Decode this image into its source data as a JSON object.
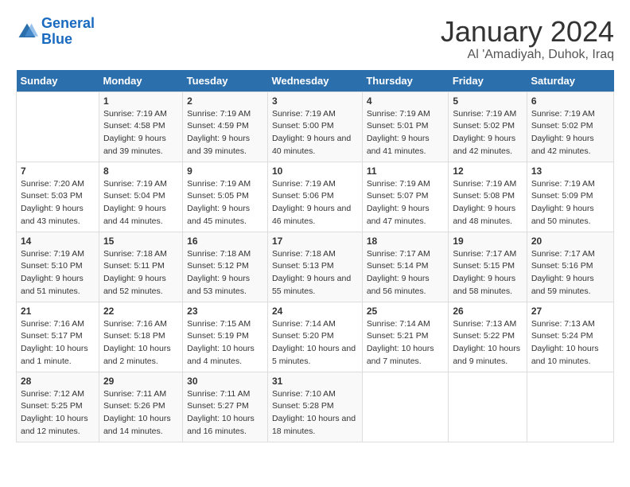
{
  "header": {
    "logo_line1": "General",
    "logo_line2": "Blue",
    "title": "January 2024",
    "subtitle": "Al 'Amadiyah, Duhok, Iraq"
  },
  "days_of_week": [
    "Sunday",
    "Monday",
    "Tuesday",
    "Wednesday",
    "Thursday",
    "Friday",
    "Saturday"
  ],
  "weeks": [
    [
      {
        "num": "",
        "sunrise": "",
        "sunset": "",
        "daylight": ""
      },
      {
        "num": "1",
        "sunrise": "Sunrise: 7:19 AM",
        "sunset": "Sunset: 4:58 PM",
        "daylight": "Daylight: 9 hours and 39 minutes."
      },
      {
        "num": "2",
        "sunrise": "Sunrise: 7:19 AM",
        "sunset": "Sunset: 4:59 PM",
        "daylight": "Daylight: 9 hours and 39 minutes."
      },
      {
        "num": "3",
        "sunrise": "Sunrise: 7:19 AM",
        "sunset": "Sunset: 5:00 PM",
        "daylight": "Daylight: 9 hours and 40 minutes."
      },
      {
        "num": "4",
        "sunrise": "Sunrise: 7:19 AM",
        "sunset": "Sunset: 5:01 PM",
        "daylight": "Daylight: 9 hours and 41 minutes."
      },
      {
        "num": "5",
        "sunrise": "Sunrise: 7:19 AM",
        "sunset": "Sunset: 5:02 PM",
        "daylight": "Daylight: 9 hours and 42 minutes."
      },
      {
        "num": "6",
        "sunrise": "Sunrise: 7:19 AM",
        "sunset": "Sunset: 5:02 PM",
        "daylight": "Daylight: 9 hours and 42 minutes."
      }
    ],
    [
      {
        "num": "7",
        "sunrise": "Sunrise: 7:20 AM",
        "sunset": "Sunset: 5:03 PM",
        "daylight": "Daylight: 9 hours and 43 minutes."
      },
      {
        "num": "8",
        "sunrise": "Sunrise: 7:19 AM",
        "sunset": "Sunset: 5:04 PM",
        "daylight": "Daylight: 9 hours and 44 minutes."
      },
      {
        "num": "9",
        "sunrise": "Sunrise: 7:19 AM",
        "sunset": "Sunset: 5:05 PM",
        "daylight": "Daylight: 9 hours and 45 minutes."
      },
      {
        "num": "10",
        "sunrise": "Sunrise: 7:19 AM",
        "sunset": "Sunset: 5:06 PM",
        "daylight": "Daylight: 9 hours and 46 minutes."
      },
      {
        "num": "11",
        "sunrise": "Sunrise: 7:19 AM",
        "sunset": "Sunset: 5:07 PM",
        "daylight": "Daylight: 9 hours and 47 minutes."
      },
      {
        "num": "12",
        "sunrise": "Sunrise: 7:19 AM",
        "sunset": "Sunset: 5:08 PM",
        "daylight": "Daylight: 9 hours and 48 minutes."
      },
      {
        "num": "13",
        "sunrise": "Sunrise: 7:19 AM",
        "sunset": "Sunset: 5:09 PM",
        "daylight": "Daylight: 9 hours and 50 minutes."
      }
    ],
    [
      {
        "num": "14",
        "sunrise": "Sunrise: 7:19 AM",
        "sunset": "Sunset: 5:10 PM",
        "daylight": "Daylight: 9 hours and 51 minutes."
      },
      {
        "num": "15",
        "sunrise": "Sunrise: 7:18 AM",
        "sunset": "Sunset: 5:11 PM",
        "daylight": "Daylight: 9 hours and 52 minutes."
      },
      {
        "num": "16",
        "sunrise": "Sunrise: 7:18 AM",
        "sunset": "Sunset: 5:12 PM",
        "daylight": "Daylight: 9 hours and 53 minutes."
      },
      {
        "num": "17",
        "sunrise": "Sunrise: 7:18 AM",
        "sunset": "Sunset: 5:13 PM",
        "daylight": "Daylight: 9 hours and 55 minutes."
      },
      {
        "num": "18",
        "sunrise": "Sunrise: 7:17 AM",
        "sunset": "Sunset: 5:14 PM",
        "daylight": "Daylight: 9 hours and 56 minutes."
      },
      {
        "num": "19",
        "sunrise": "Sunrise: 7:17 AM",
        "sunset": "Sunset: 5:15 PM",
        "daylight": "Daylight: 9 hours and 58 minutes."
      },
      {
        "num": "20",
        "sunrise": "Sunrise: 7:17 AM",
        "sunset": "Sunset: 5:16 PM",
        "daylight": "Daylight: 9 hours and 59 minutes."
      }
    ],
    [
      {
        "num": "21",
        "sunrise": "Sunrise: 7:16 AM",
        "sunset": "Sunset: 5:17 PM",
        "daylight": "Daylight: 10 hours and 1 minute."
      },
      {
        "num": "22",
        "sunrise": "Sunrise: 7:16 AM",
        "sunset": "Sunset: 5:18 PM",
        "daylight": "Daylight: 10 hours and 2 minutes."
      },
      {
        "num": "23",
        "sunrise": "Sunrise: 7:15 AM",
        "sunset": "Sunset: 5:19 PM",
        "daylight": "Daylight: 10 hours and 4 minutes."
      },
      {
        "num": "24",
        "sunrise": "Sunrise: 7:14 AM",
        "sunset": "Sunset: 5:20 PM",
        "daylight": "Daylight: 10 hours and 5 minutes."
      },
      {
        "num": "25",
        "sunrise": "Sunrise: 7:14 AM",
        "sunset": "Sunset: 5:21 PM",
        "daylight": "Daylight: 10 hours and 7 minutes."
      },
      {
        "num": "26",
        "sunrise": "Sunrise: 7:13 AM",
        "sunset": "Sunset: 5:22 PM",
        "daylight": "Daylight: 10 hours and 9 minutes."
      },
      {
        "num": "27",
        "sunrise": "Sunrise: 7:13 AM",
        "sunset": "Sunset: 5:24 PM",
        "daylight": "Daylight: 10 hours and 10 minutes."
      }
    ],
    [
      {
        "num": "28",
        "sunrise": "Sunrise: 7:12 AM",
        "sunset": "Sunset: 5:25 PM",
        "daylight": "Daylight: 10 hours and 12 minutes."
      },
      {
        "num": "29",
        "sunrise": "Sunrise: 7:11 AM",
        "sunset": "Sunset: 5:26 PM",
        "daylight": "Daylight: 10 hours and 14 minutes."
      },
      {
        "num": "30",
        "sunrise": "Sunrise: 7:11 AM",
        "sunset": "Sunset: 5:27 PM",
        "daylight": "Daylight: 10 hours and 16 minutes."
      },
      {
        "num": "31",
        "sunrise": "Sunrise: 7:10 AM",
        "sunset": "Sunset: 5:28 PM",
        "daylight": "Daylight: 10 hours and 18 minutes."
      },
      {
        "num": "",
        "sunrise": "",
        "sunset": "",
        "daylight": ""
      },
      {
        "num": "",
        "sunrise": "",
        "sunset": "",
        "daylight": ""
      },
      {
        "num": "",
        "sunrise": "",
        "sunset": "",
        "daylight": ""
      }
    ]
  ]
}
